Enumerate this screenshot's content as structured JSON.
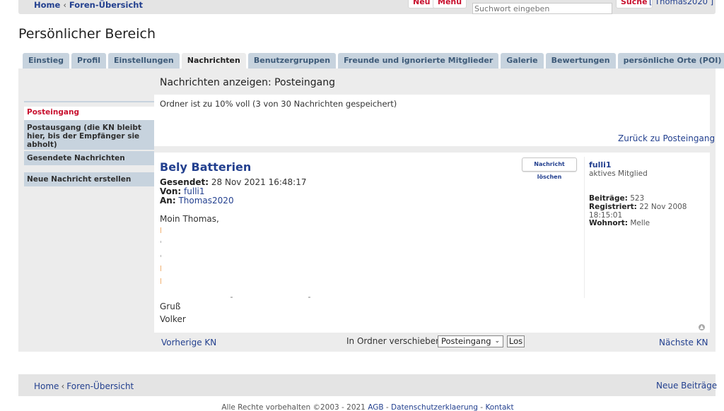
{
  "topbar": {
    "home": "Home",
    "sep": "‹",
    "forum_overview": "Foren-Übersicht",
    "new_label": "Neu",
    "menu_label": "Menu",
    "search_placeholder": "Suchwort eingeben",
    "search_button": "Suche",
    "user": "[ Thomas2020 ]"
  },
  "page_title": "Persönlicher Bereich",
  "tabs": [
    {
      "label": "Einstieg",
      "active": false
    },
    {
      "label": "Profil",
      "active": false
    },
    {
      "label": "Einstellungen",
      "active": false
    },
    {
      "label": "Nachrichten",
      "active": true
    },
    {
      "label": "Benutzergruppen",
      "active": false
    },
    {
      "label": "Freunde und ignorierte Mitglieder",
      "active": false
    },
    {
      "label": "Galerie",
      "active": false
    },
    {
      "label": "Bewertungen",
      "active": false
    },
    {
      "label": "persönliche Orte (POI)",
      "active": false
    }
  ],
  "sidebar": {
    "items": [
      {
        "label": "Posteingang"
      },
      {
        "label": "Postausgang (die KN bleibt hier, bis der Empfänger sie abholt)"
      },
      {
        "label": "Gesendete Nachrichten"
      },
      {
        "label": "Neue Nachricht erstellen"
      }
    ]
  },
  "main": {
    "section_title": "Nachrichten anzeigen: Posteingang",
    "folder_status": "Ordner ist zu 10% voll (3 von 30 Nachrichten gespeichert)",
    "back_link": "Zurück zu Posteingang"
  },
  "message": {
    "subject": "Bely Batterien",
    "delete_button": "Nachricht löschen",
    "sent_label": "Gesendet:",
    "sent_value": "28 Nov 2021 16:48:17",
    "from_label": "Von:",
    "from_value": "fulli1",
    "to_label": "An:",
    "to_value": "Thomas2020",
    "greeting": "Moin Thomas,",
    "closing": "Gruß",
    "signature": "Volker"
  },
  "profile": {
    "name": "fulli1",
    "rank": "aktives Mitglied",
    "posts_label": "Beiträge:",
    "posts_value": "523",
    "registered_label": "Registriert:",
    "registered_value": "22 Nov 2008",
    "registered_time": "18:15:01",
    "location_label": "Wohnort:",
    "location_value": "Melle"
  },
  "bottom": {
    "prev": "Vorherige KN",
    "move_label": "In Ordner verschieben:",
    "folder_selected": "Posteingang",
    "go_button": "Los",
    "next": "Nächste KN"
  },
  "footer": {
    "home": "Home",
    "sep": "‹",
    "forum_overview": "Foren-Übersicht",
    "new_posts": "Neue Beiträge",
    "copyright": "Alle Rechte vorbehalten ©2003 - 2021",
    "dash": "-",
    "agb": "AGB",
    "privacy": "Datenschutzerklaerung",
    "contact": "Kontakt"
  },
  "colors": {
    "accent_red": "#c8102e",
    "link_blue": "#23408f",
    "tab_bg": "#c7d3de"
  }
}
